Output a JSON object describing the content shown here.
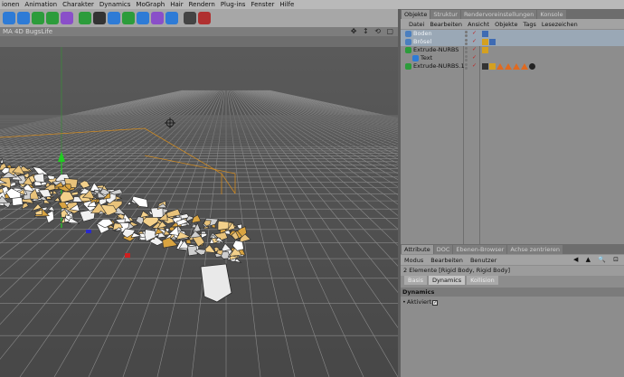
{
  "menubar": {
    "items": [
      "ionen",
      "Animation",
      "Charakter",
      "Dynamics",
      "MoGraph",
      "Hair",
      "Rendern",
      "Plug-ins",
      "Fenster",
      "Hilfe"
    ]
  },
  "toolbar": {
    "icons": [
      {
        "name": "cube-icon",
        "color": "#2e7bd6"
      },
      {
        "name": "pen-icon",
        "color": "#2e7bd6"
      },
      {
        "name": "subdivision-icon",
        "color": "#2c9c3b"
      },
      {
        "name": "array-icon",
        "color": "#2c9c3b"
      },
      {
        "name": "deformer-icon",
        "color": "#8a4fc9"
      },
      {
        "name": "scene-icon",
        "color": "#2c9c3b"
      },
      {
        "name": "camera-icon",
        "color": "#333333"
      },
      {
        "name": "light-icon",
        "color": "#2e7bd6"
      },
      {
        "name": "floor-icon",
        "color": "#2c9c3b"
      },
      {
        "name": "sky-icon",
        "color": "#2e7bd6"
      },
      {
        "name": "material-icon",
        "color": "#8a4fc9"
      },
      {
        "name": "tag-icon",
        "color": "#2e7bd6"
      },
      {
        "name": "render-view-icon",
        "color": "#444444"
      },
      {
        "name": "render-settings-icon",
        "color": "#b03030"
      }
    ]
  },
  "viewport": {
    "title": "MA 4D BugsLife",
    "controls": "✥ ↕ ⟲ ▢"
  },
  "objects_panel": {
    "tabs": [
      "Objekte",
      "Struktur",
      "Rendervoreinstellungen",
      "Konsole"
    ],
    "active_tab": 0,
    "menu": [
      "Datei",
      "Bearbeiten",
      "Ansicht",
      "Objekte",
      "Tags",
      "Lesezeichen"
    ],
    "objects": [
      {
        "name": "Boden",
        "icon_color": "#4a7fbf",
        "indent": 0,
        "tags": [
          "#3e6bb3"
        ]
      },
      {
        "name": "Brösel",
        "icon_color": "#4a7fbf",
        "indent": 0,
        "tags": [
          "#d4a020",
          "#3e6bb3"
        ]
      },
      {
        "name": "Extrude-NURBS",
        "icon_color": "#2c9c3b",
        "indent": 0,
        "tags": [
          "#d4a020"
        ]
      },
      {
        "name": "Text",
        "icon_color": "#2e7bd6",
        "indent": 1,
        "tags": []
      },
      {
        "name": "Extrude-NURBS.1",
        "icon_color": "#2c9c3b",
        "indent": 0,
        "tags": [
          "#333333",
          "#d4a020",
          "#e06a20",
          "#e06a20",
          "#e06a20",
          "#e06a20",
          "#222222"
        ]
      }
    ]
  },
  "attr_panel": {
    "tabs": [
      "Attribute",
      "DOC",
      "Ebenen-Browser",
      "Achse zentrieren"
    ],
    "active_tab": 0,
    "menu": [
      "Modus",
      "Bearbeiten",
      "Benutzer"
    ],
    "nav": "◀ ▲ 🔍 ⊡",
    "elements_label": "2 Elemente [Rigid Body, Rigid Body]",
    "subtabs": [
      "Basis",
      "Dynamics",
      "Kollision"
    ],
    "active_subtab": 1,
    "section": "Dynamics",
    "field_label": "Aktiviert",
    "field_checked": "✓"
  }
}
